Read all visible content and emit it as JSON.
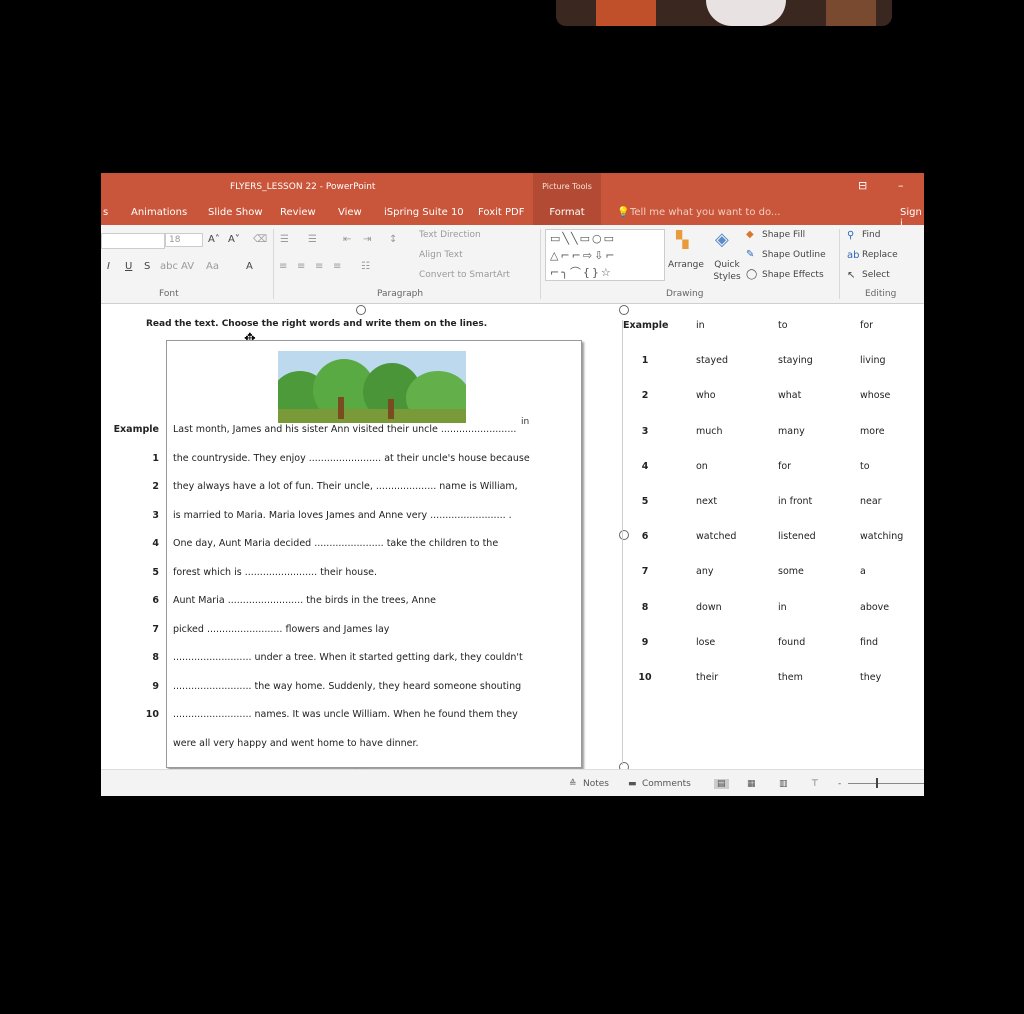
{
  "window": {
    "title": "FLYERS_LESSON 22 - PowerPoint",
    "context_tab": "Picture Tools",
    "restore_icon": "restore-icon",
    "minimize_label": "–"
  },
  "tabs": [
    "s",
    "Animations",
    "Slide Show",
    "Review",
    "View",
    "iSpring Suite 10",
    "Foxit PDF",
    "Format"
  ],
  "tell_me": "Tell me what you want to do...",
  "sign_in": "Sign i",
  "ribbon": {
    "font_size": "18",
    "groups": {
      "font": "Font",
      "paragraph": "Paragraph",
      "drawing": "Drawing",
      "editing": "Editing"
    },
    "text_direction": "Text Direction",
    "align_text": "Align Text",
    "convert_smartart": "Convert to SmartArt",
    "arrange": "Arrange",
    "quick_styles": "Quick Styles",
    "shape_fill": "Shape Fill",
    "shape_outline": "Shape Outline",
    "shape_effects": "Shape Effects",
    "find": "Find",
    "replace": "Replace",
    "select": "Select"
  },
  "slide": {
    "instruction": "Read the text. Choose the right words and write them on the lines.",
    "example_answer": "in",
    "lines": [
      {
        "num": "Example",
        "text": "Last month, James and his sister Ann visited their uncle ........................."
      },
      {
        "num": "1",
        "text": "the countryside. They enjoy ........................ at their uncle's house because"
      },
      {
        "num": "2",
        "text": "they always have a lot of fun. Their uncle, .................... name is William,"
      },
      {
        "num": "3",
        "text": "is married to Maria. Maria loves James and Anne very ......................... ."
      },
      {
        "num": "4",
        "text": "One day, Aunt Maria decided ....................... take the children to the"
      },
      {
        "num": "5",
        "text": "forest which is ........................ their house."
      },
      {
        "num": "6",
        "text": "Aunt Maria ......................... the birds in the trees, Anne"
      },
      {
        "num": "7",
        "text": "picked ......................... flowers and James lay"
      },
      {
        "num": "8",
        "text": ".......................... under a tree. When it started getting dark, they couldn't"
      },
      {
        "num": "9",
        "text": ".......................... the way home. Suddenly, they heard someone shouting"
      },
      {
        "num": "10",
        "text": ".......................... names. It was uncle William. When he found them they"
      },
      {
        "num": "",
        "text": "were all very happy and went home to have dinner."
      }
    ],
    "options": [
      {
        "num": "Example",
        "a": "in",
        "b": "to",
        "c": "for"
      },
      {
        "num": "1",
        "a": "stayed",
        "b": "staying",
        "c": "living"
      },
      {
        "num": "2",
        "a": "who",
        "b": "what",
        "c": "whose"
      },
      {
        "num": "3",
        "a": "much",
        "b": "many",
        "c": "more"
      },
      {
        "num": "4",
        "a": "on",
        "b": "for",
        "c": "to"
      },
      {
        "num": "5",
        "a": "next",
        "b": "in front",
        "c": "near"
      },
      {
        "num": "6",
        "a": "watched",
        "b": "listened",
        "c": "watching"
      },
      {
        "num": "7",
        "a": "any",
        "b": "some",
        "c": "a"
      },
      {
        "num": "8",
        "a": "down",
        "b": "in",
        "c": "above"
      },
      {
        "num": "9",
        "a": "lose",
        "b": "found",
        "c": "find"
      },
      {
        "num": "10",
        "a": "their",
        "b": "them",
        "c": "they"
      }
    ]
  },
  "status": {
    "notes": "Notes",
    "comments": "Comments"
  },
  "colors": {
    "title_bar": "#c9553a",
    "context_tab": "#b34a33"
  }
}
